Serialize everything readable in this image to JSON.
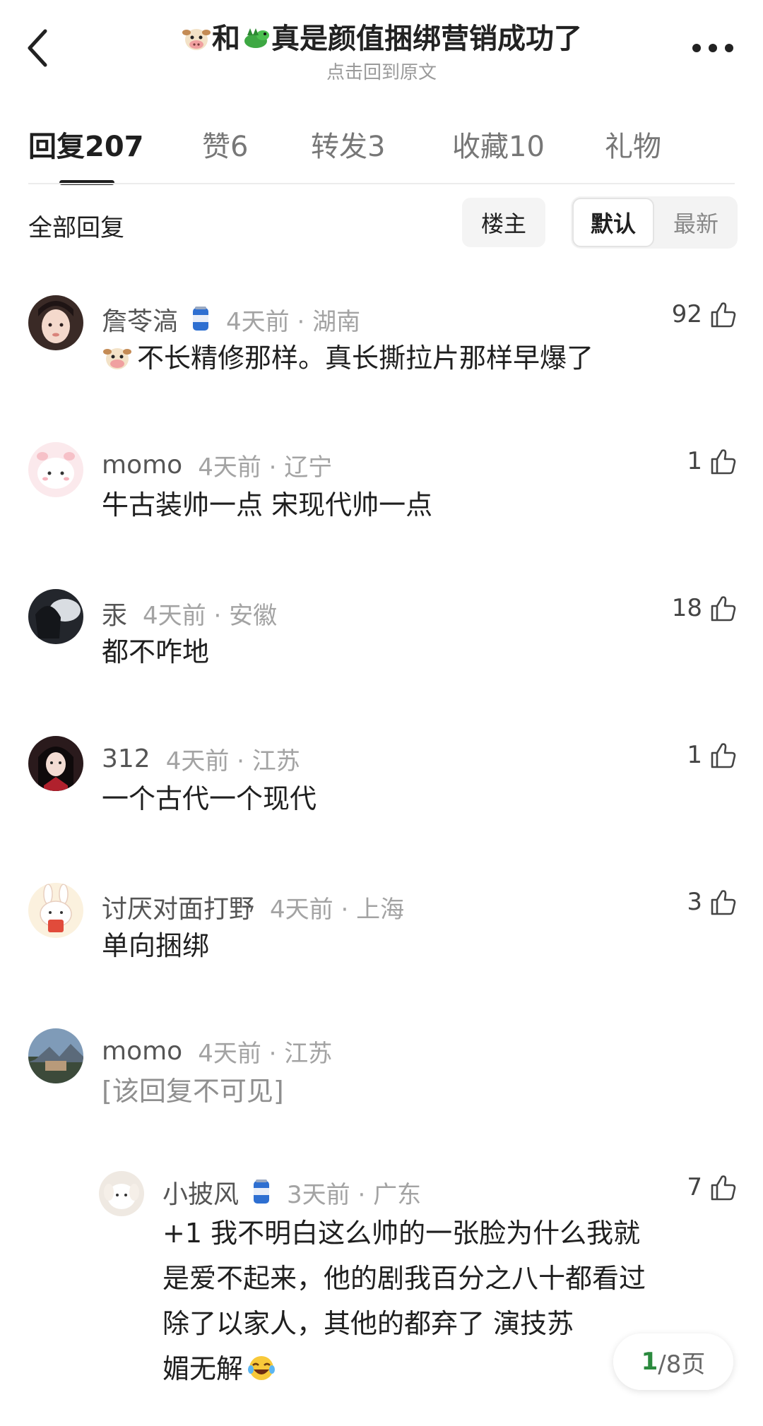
{
  "header": {
    "title_prefix_icon": "cow-emoji",
    "title_join": "和",
    "title_mid_icon": "dragon-emoji",
    "title_text": "真是颜值捆绑营销成功了",
    "subtitle": "点击回到原文"
  },
  "tabs": [
    {
      "label": "回复207",
      "active": true
    },
    {
      "label": "赞6",
      "active": false
    },
    {
      "label": "转发3",
      "active": false
    },
    {
      "label": "收藏10",
      "active": false
    },
    {
      "label": "礼物",
      "active": false
    }
  ],
  "filter": {
    "label": "全部回复",
    "owner_button": "楼主",
    "sort_default": "默认",
    "sort_latest": "最新"
  },
  "comments": [
    {
      "name": "詹苓滈",
      "badge": "can-icon",
      "time": "4天前 · 湖南",
      "likes": "92",
      "text_icon": "cow-emoji",
      "text": "不长精修那样。真长撕拉片那样早爆了"
    },
    {
      "name": "momo",
      "time": "4天前 · 辽宁",
      "likes": "1",
      "text": "牛古装帅一点 宋现代帅一点"
    },
    {
      "name": "汞",
      "time": "4天前 · 安徽",
      "likes": "18",
      "text": "都不咋地"
    },
    {
      "name": "312",
      "time": "4天前 · 江苏",
      "likes": "1",
      "text": "一个古代一个现代"
    },
    {
      "name": "讨厌对面打野",
      "time": "4天前 · 上海",
      "likes": "3",
      "text": "单向捆绑"
    },
    {
      "name": "momo",
      "time": "4天前 · 江苏",
      "likes": "",
      "text": "[该回复不可见]"
    }
  ],
  "reply": {
    "name": "小披风",
    "badge": "can-icon",
    "time": "3天前 · 广东",
    "likes": "7",
    "lines": [
      "+1 我不明白这么帅的一张脸为什么我就",
      "是爱不起来，他的剧我百分之八十都看过",
      "除了以家人，其他的都弃了 演技苏",
      "媚无解"
    ],
    "end_icon": "laughing-emoji"
  },
  "pagination": {
    "current": "1",
    "total_label": "/8页"
  }
}
